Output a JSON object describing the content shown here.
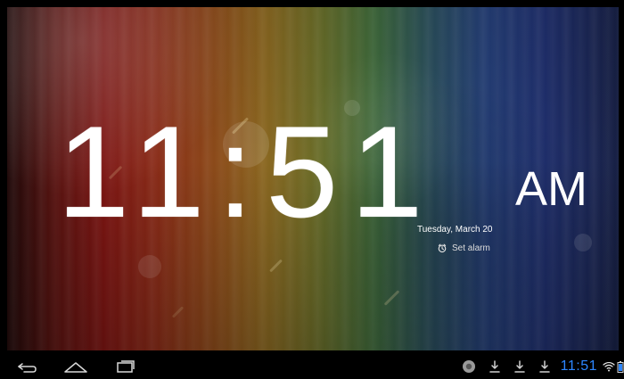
{
  "clock": {
    "time": "11:51",
    "meridiem": "AM",
    "date": "Tuesday, March 20",
    "alarm_label": "Set alarm"
  },
  "navigation": {
    "back_icon": "back-icon",
    "home_icon": "home-icon",
    "recent_icon": "recent-apps-icon"
  },
  "status_bar": {
    "time": "11:51",
    "icons": [
      "notification-icon",
      "download-icon",
      "download-icon",
      "download-icon",
      "wifi-icon",
      "battery-icon"
    ],
    "accent": "#2d86ff"
  },
  "colors": {
    "foreground": "#ffffff",
    "navbar": "#000000",
    "status_blue": "#2d86ff"
  }
}
